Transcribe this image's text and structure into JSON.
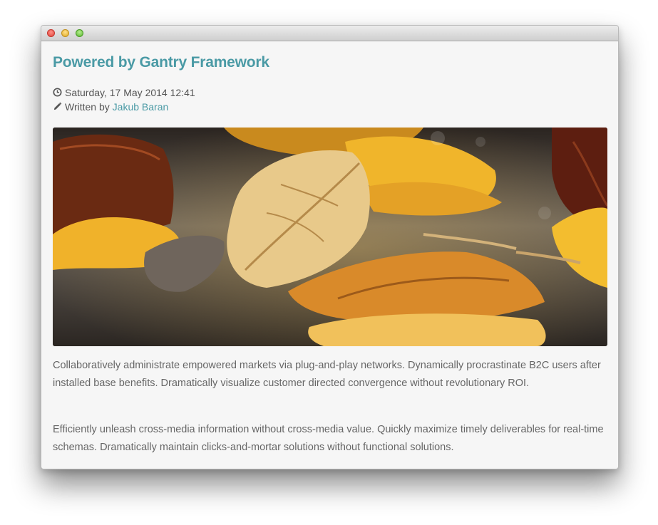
{
  "window": {
    "controls": [
      "close",
      "minimize",
      "maximize"
    ]
  },
  "article": {
    "title": "Powered by Gantry Framework",
    "date_icon": "clock-icon",
    "date": "Saturday, 17 May 2014 12:41",
    "author_icon": "pencil-icon",
    "written_by_label": "Written by",
    "author_name": "Jakub Baran",
    "image_description_icon": "autumn-leaves-photo",
    "paragraphs": [
      "Collaboratively administrate empowered markets via plug-and-play networks. Dynamically procrastinate B2C users after installed base benefits. Dramatically visualize customer directed convergence without revolutionary ROI.",
      "Efficiently unleash cross-media information without cross-media value. Quickly maximize timely deliverables for real-time schemas. Dramatically maintain clicks-and-mortar solutions without functional solutions."
    ]
  },
  "colors": {
    "accent": "#4a9aa5",
    "text": "#666666",
    "background": "#f6f6f6"
  }
}
